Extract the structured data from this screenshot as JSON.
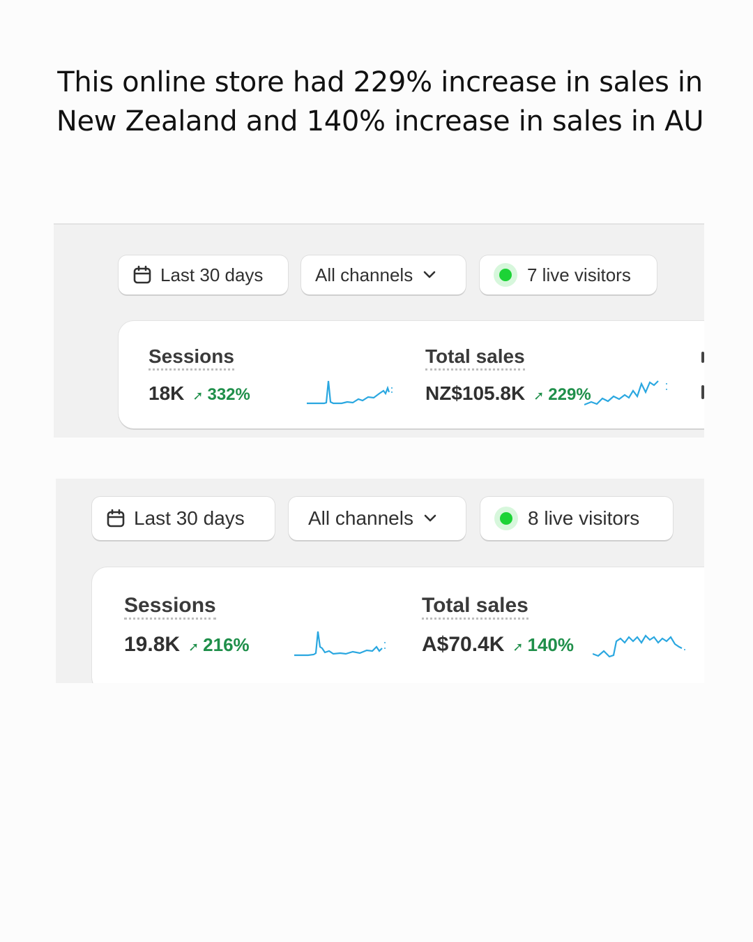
{
  "headline": {
    "line1": "This online store had 229% increase in sales in",
    "line2": "New Zealand and 140% increase in sales in AU"
  },
  "panels": {
    "nz": {
      "date_range": "Last 30 days",
      "channels": "All channels",
      "live_visitors": "7 live visitors",
      "sessions": {
        "label": "Sessions",
        "value": "18K",
        "change": "332%"
      },
      "sales": {
        "label": "Total sales",
        "value": "NZ$105.8K",
        "change": "229%"
      }
    },
    "au": {
      "date_range": "Last 30 days",
      "channels": "All channels",
      "live_visitors": "8 live visitors",
      "sessions": {
        "label": "Sessions",
        "value": "19.8K",
        "change": "216%"
      },
      "sales": {
        "label": "Total sales",
        "value": "A$70.4K",
        "change": "140%"
      }
    }
  },
  "icons": {
    "date": "calendar-icon",
    "dropdown": "chevron-down-icon",
    "live": "live-status-dot",
    "trend": "arrow-up-right-icon"
  },
  "colors": {
    "positive": "#1f8f4a",
    "sparkline": "#2aa7e0",
    "live_dot": "#1cd336"
  }
}
